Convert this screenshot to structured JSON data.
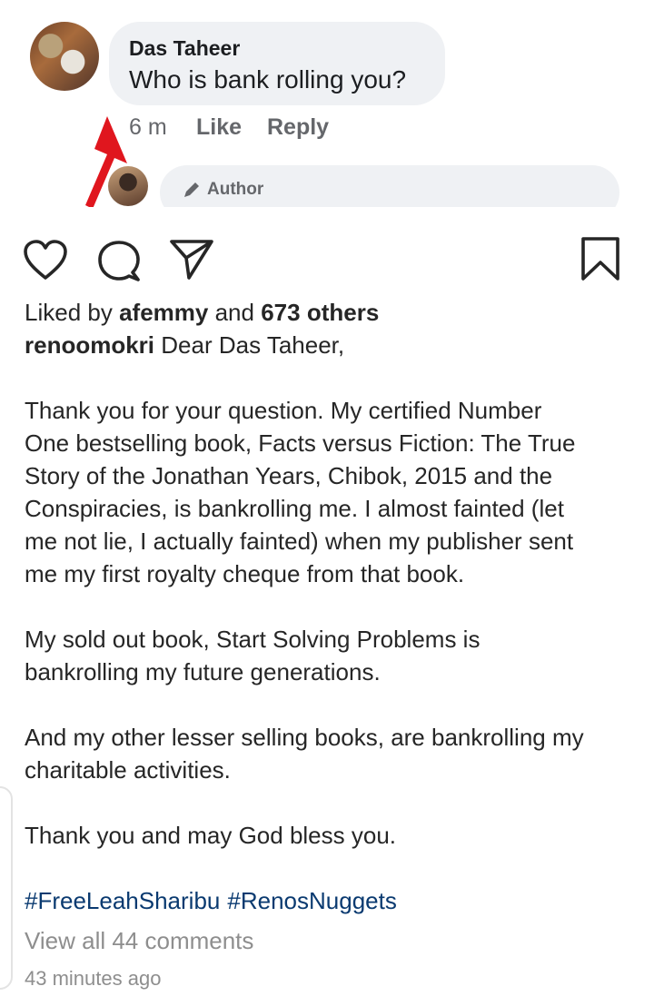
{
  "comment": {
    "author": "Das Taheer",
    "text": "Who is bank rolling you?",
    "time": "6 m",
    "like_label": "Like",
    "reply_label": "Reply",
    "reply_box_tag": "Author"
  },
  "post": {
    "liked_by_prefix": "Liked by",
    "liked_by_user": "afemmy",
    "liked_by_and": "and",
    "liked_by_others": "673 others",
    "username": "renoomokri",
    "caption_first_line": "Dear Das Taheer,",
    "paragraph1": [
      "Thank you for your question. My certified Number",
      "One bestselling book, Facts versus Fiction: The True",
      "Story of the Jonathan Years, Chibok, 2015 and the",
      "Conspiracies, is bankrolling me. I almost fainted (let",
      "me not lie, I actually fainted) when my publisher sent",
      "me my first royalty cheque from that book."
    ],
    "paragraph2": [
      "My sold out book, Start Solving Problems is",
      "bankrolling my future generations."
    ],
    "paragraph3": [
      "And my other lesser selling books, are bankrolling my",
      "charitable activities."
    ],
    "paragraph4": [
      "Thank you and may God bless you."
    ],
    "hashtags": [
      "#FreeLeahSharibu",
      "#RenosNuggets"
    ],
    "view_comments": "View all 44 comments",
    "timestamp": "43 minutes ago"
  },
  "icons": [
    "heart-icon",
    "comment-icon",
    "share-icon",
    "bookmark-icon",
    "pencil-icon",
    "arrow-annotation"
  ],
  "colors": {
    "text": "#262626",
    "hashtag": "#0a3a70",
    "muted": "#8e8e8e",
    "bubble": "#eff1f4",
    "arrow": "#e0161e"
  }
}
